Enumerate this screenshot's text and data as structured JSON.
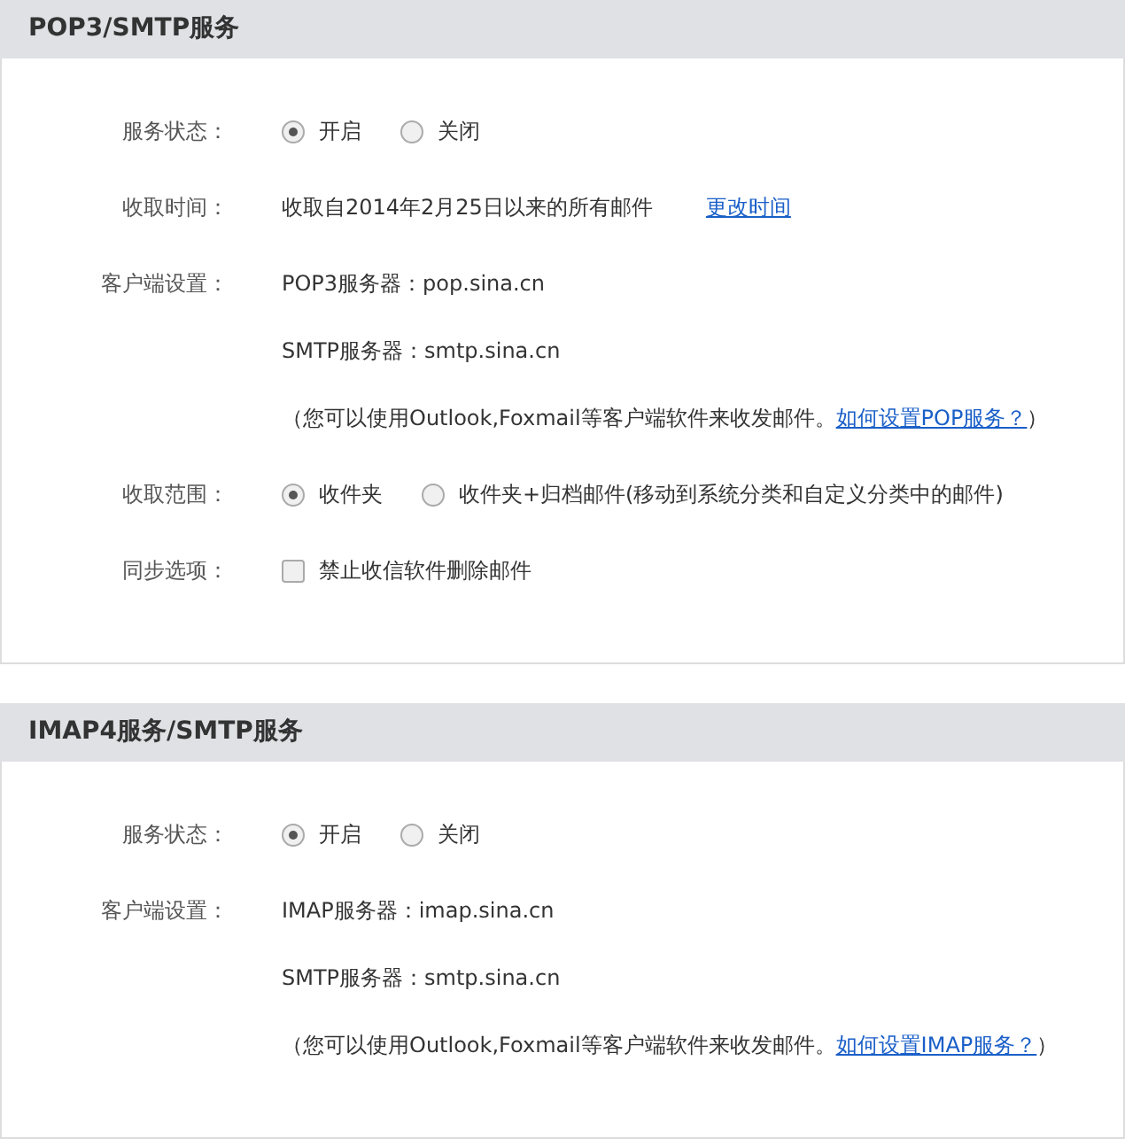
{
  "sections": [
    {
      "title": "POP3/SMTP服务",
      "rows": [
        {
          "kind": "radio",
          "label": "服务状态：",
          "options": [
            {
              "label": "开启",
              "selected": true
            },
            {
              "label": "关闭",
              "selected": false
            }
          ]
        },
        {
          "kind": "time",
          "label": "收取时间：",
          "text": "收取自2014年2月25日以来的所有邮件",
          "link": "更改时间"
        },
        {
          "kind": "client",
          "label": "客户端设置：",
          "lines": [
            "POP3服务器：pop.sina.cn",
            "SMTP服务器：smtp.sina.cn"
          ],
          "note": {
            "prefix": "（您可以使用Outlook,Foxmail等客户端软件来收发邮件。",
            "link": "如何设置POP服务？",
            "suffix": "）"
          }
        },
        {
          "kind": "radio",
          "label": "收取范围：",
          "options": [
            {
              "label": "收件夹",
              "selected": true
            },
            {
              "label": "收件夹+归档邮件(移动到系统分类和自定义分类中的邮件)",
              "selected": false
            }
          ]
        },
        {
          "kind": "checkbox",
          "label": "同步选项：",
          "option": {
            "label": "禁止收信软件删除邮件",
            "checked": false
          }
        }
      ]
    },
    {
      "title": "IMAP4服务/SMTP服务",
      "rows": [
        {
          "kind": "radio",
          "label": "服务状态：",
          "options": [
            {
              "label": "开启",
              "selected": true
            },
            {
              "label": "关闭",
              "selected": false
            }
          ]
        },
        {
          "kind": "client",
          "label": "客户端设置：",
          "lines": [
            "IMAP服务器：imap.sina.cn",
            "SMTP服务器：smtp.sina.cn"
          ],
          "note": {
            "prefix": "（您可以使用Outlook,Foxmail等客户端软件来收发邮件。",
            "link": "如何设置IMAP服务？",
            "suffix": "）"
          }
        }
      ]
    }
  ]
}
